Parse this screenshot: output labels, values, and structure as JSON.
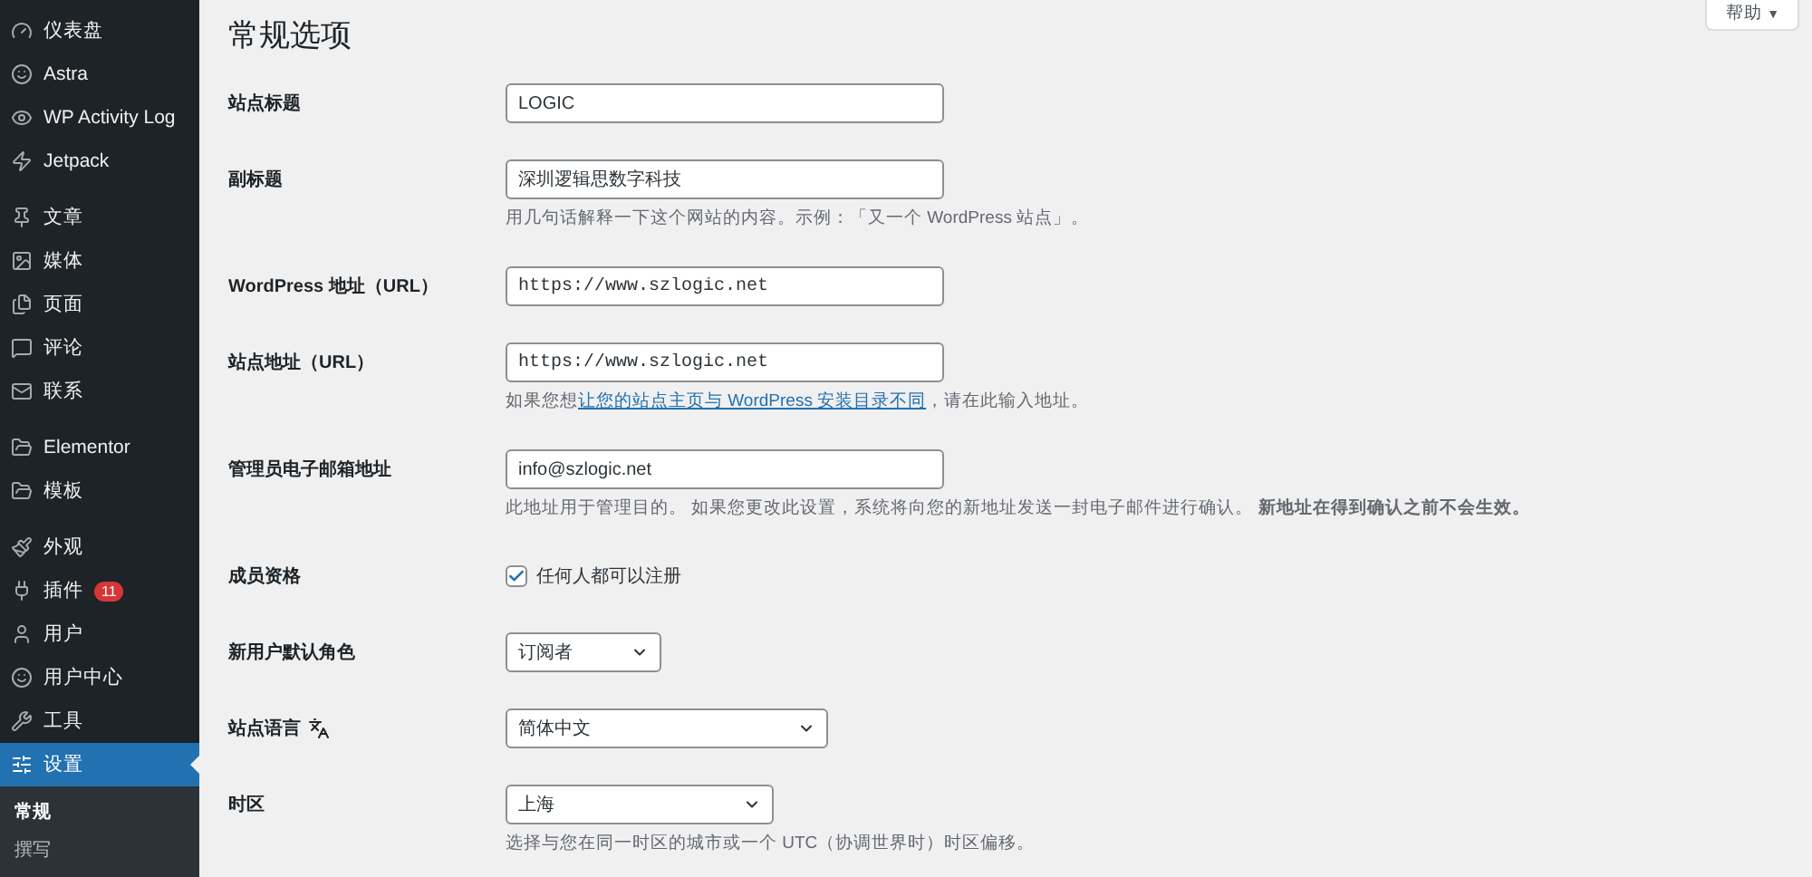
{
  "sidebar": {
    "groups": [
      [
        {
          "label": "仪表盘",
          "selected": false
        },
        {
          "label": "Astra",
          "selected": false
        },
        {
          "label": "WP Activity Log",
          "selected": false
        },
        {
          "label": "Jetpack",
          "selected": false
        }
      ],
      [
        {
          "label": "文章",
          "selected": false
        },
        {
          "label": "媒体",
          "selected": false
        },
        {
          "label": "页面",
          "selected": false
        },
        {
          "label": "评论",
          "selected": false
        },
        {
          "label": "联系",
          "selected": false
        }
      ],
      [
        {
          "label": "Elementor",
          "selected": false
        },
        {
          "label": "模板",
          "selected": false
        }
      ],
      [
        {
          "label": "外观",
          "selected": false
        },
        {
          "label": "插件",
          "selected": false,
          "badge": "11"
        },
        {
          "label": "用户",
          "selected": false
        },
        {
          "label": "用户中心",
          "selected": false
        },
        {
          "label": "工具",
          "selected": false
        },
        {
          "label": "设置",
          "selected": true
        }
      ]
    ],
    "submenu": [
      {
        "label": "常规",
        "selected": true
      },
      {
        "label": "撰写",
        "selected": false
      }
    ]
  },
  "help": {
    "label": "帮助",
    "caret": "▼"
  },
  "page_title": "常规选项",
  "rows": [
    {
      "label": "站点标题",
      "kind": "text",
      "value": "LOGIC"
    },
    {
      "label": "副标题",
      "kind": "text",
      "value": "深圳逻辑思数字科技",
      "description": [
        {
          "text": "用几句话解释一下这个网站的内容。示例：「又一个 WordPress 站点」。",
          "link": false
        }
      ]
    },
    {
      "label": "WordPress 地址（URL）",
      "kind": "url",
      "value": "https://www.szlogic.net"
    },
    {
      "label": "站点地址（URL）",
      "kind": "url",
      "value": "https://www.szlogic.net",
      "description": [
        {
          "text": "如果您想",
          "link": false
        },
        {
          "text": "让您的站点主页与 WordPress 安装目录不同",
          "link": true
        },
        {
          "text": "，请在此输入地址。",
          "link": false
        }
      ]
    },
    {
      "label": "管理员电子邮箱地址",
      "kind": "text",
      "value": "info@szlogic.net",
      "description": [
        {
          "text": "此地址用于管理目的。 如果您更改此设置，系统将向您的新地址发送一封电子邮件进行确认。 **新地址在得到确认之前不会生效。**",
          "link": false
        }
      ]
    },
    {
      "label": "成员资格",
      "kind": "checkbox",
      "checked": true,
      "option": "任何人都可以注册"
    },
    {
      "label": "新用户默认角色",
      "kind": "select",
      "value": "订阅者"
    },
    {
      "label": "站点语言",
      "kind": "select",
      "value": "简体中文",
      "label_icon": true
    },
    {
      "label": "时区",
      "kind": "select",
      "value": "上海",
      "description": [
        {
          "text": "选择与您在同一时区的城市或一个 UTC（协调世界时）时区偏移。",
          "link": false
        }
      ]
    }
  ]
}
